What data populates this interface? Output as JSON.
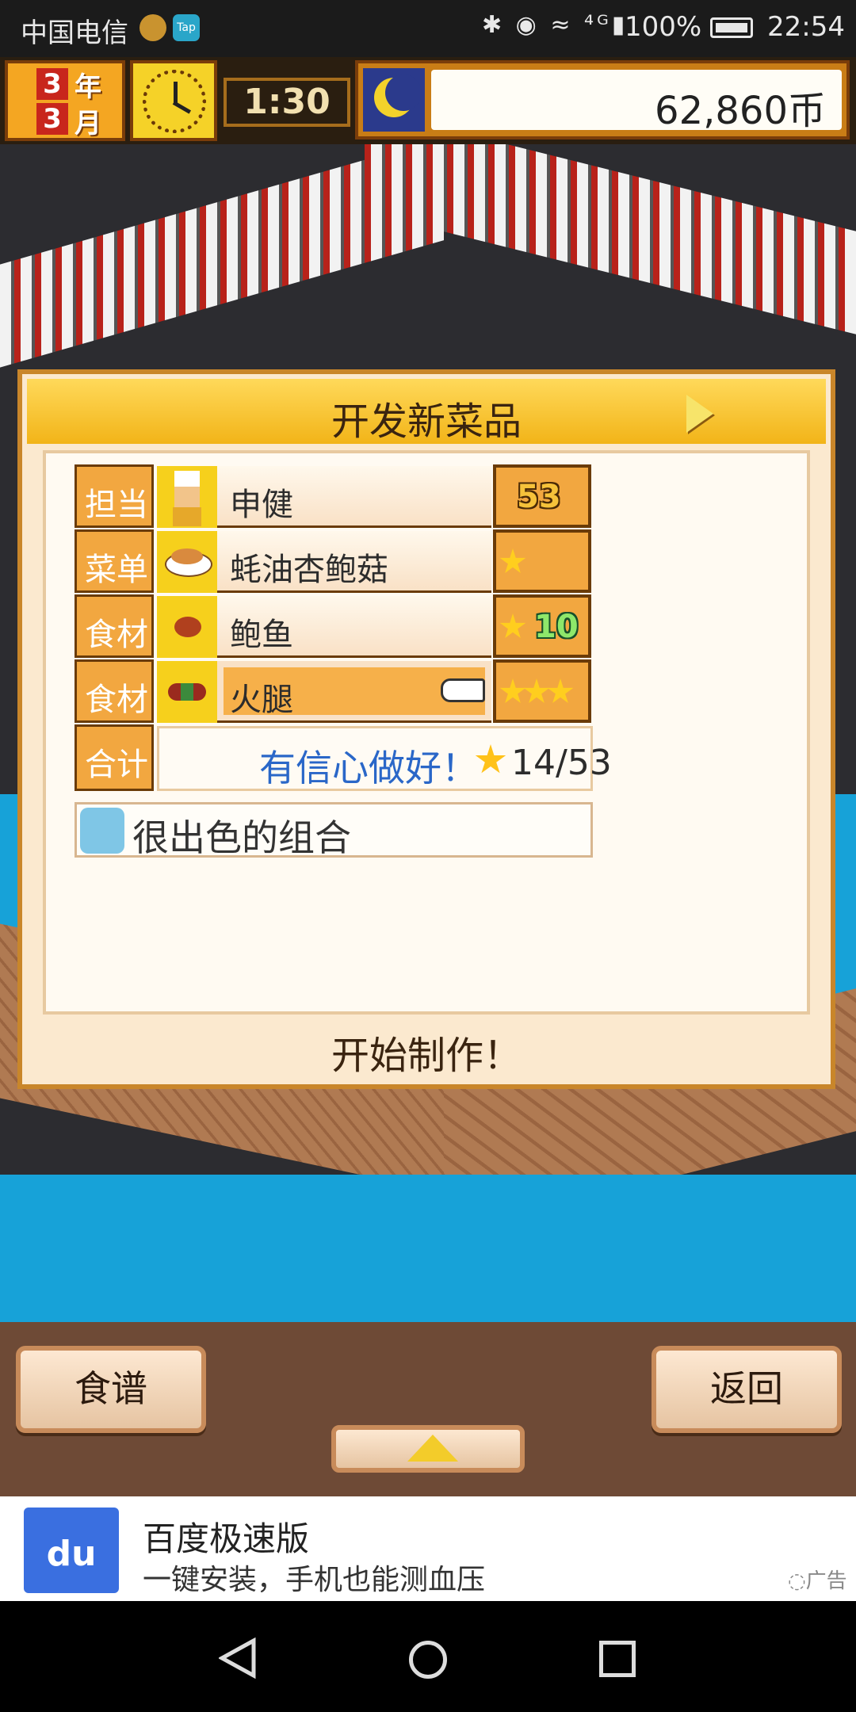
{
  "status_bar": {
    "carrier": "中国电信",
    "tap_badge": "Tap",
    "icons": "✱ ◉ ≈ ⁴ᴳ▮",
    "battery": "100%",
    "time": "22:54"
  },
  "hud": {
    "year_num": "3",
    "year_unit": "年",
    "month_num": "3",
    "month_unit": "月",
    "timer": "1:30",
    "money": "62,860币"
  },
  "dialog": {
    "title": "开发新菜品",
    "rows": [
      {
        "label": "担当",
        "name": "申健",
        "icon": "chef-icon"
      },
      {
        "label": "菜单",
        "name": "蚝油杏鲍菇",
        "icon": "dish-icon"
      },
      {
        "label": "食材",
        "name": "鲍鱼",
        "icon": "abalone-icon",
        "value": "10"
      },
      {
        "label": "食材",
        "name": "火腿",
        "icon": "ham-icon"
      }
    ],
    "chef_level": "53",
    "total_label": "合计",
    "confidence": "有信心做好！",
    "score": "14/53",
    "comment": "很出色的组合",
    "start": "开始制作！"
  },
  "menu": {
    "recipes": "食谱",
    "back": "返回"
  },
  "ad": {
    "logo_text": "du",
    "title": "百度极速版",
    "subtitle": "一键安装，手机也能测血压",
    "tag": "◌广告"
  },
  "colors": {
    "panel_orange": "#f2a740",
    "header_gold": "#f2b418",
    "water": "#17a2d8",
    "confidence_blue": "#2a67c8"
  }
}
